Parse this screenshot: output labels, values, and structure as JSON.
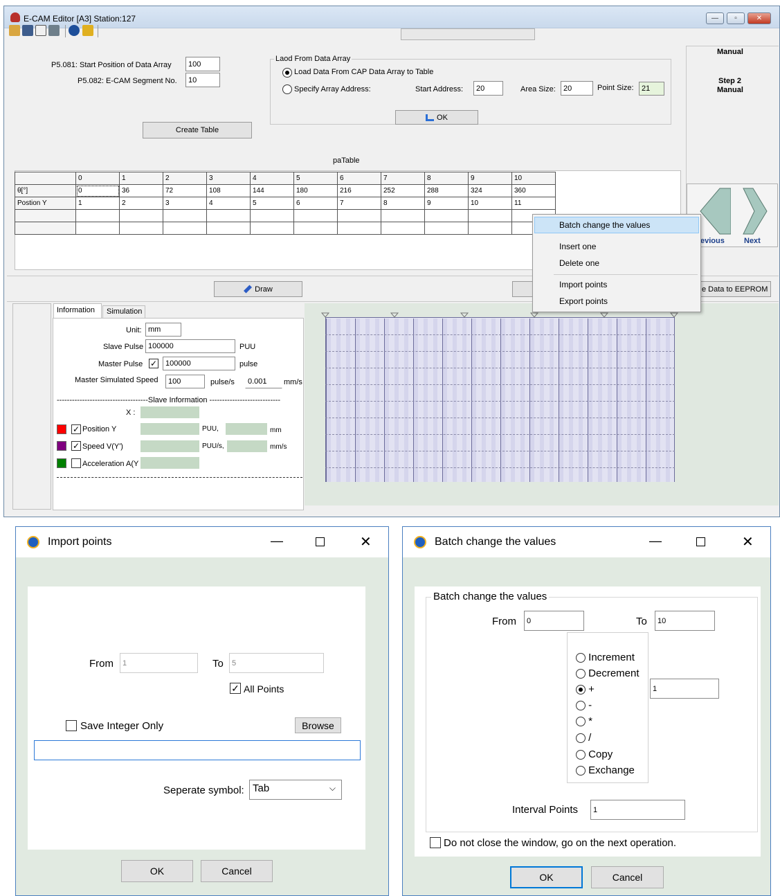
{
  "main_window": {
    "title": "E-CAM Editor [A3] Station:127",
    "controls": {
      "minimize": "—",
      "maximize": "▫",
      "close": "✕"
    }
  },
  "params": {
    "start_position_label": "P5.081: Start Position of Data Array",
    "start_position_value": "100",
    "segment_label": "P5.082: E-CAM Segment No.",
    "segment_value": "10",
    "create_table_button": "Create Table"
  },
  "load_group": {
    "title": "Laod From Data Array",
    "option_cap": "Load Data From CAP Data Array to Table",
    "option_specify": "Specify Array Address:",
    "start_address_label": "Start Address:",
    "start_address_value": "20",
    "area_size_label": "Area Size:",
    "area_size_value": "20",
    "point_size_label": "Point Size:",
    "point_size_value": "21",
    "ok_button": "OK"
  },
  "right_panel": {
    "mode": "Manual",
    "step_line1": "Step 2",
    "step_line2": "Manual",
    "previous_label": "evious",
    "next_label": "Next"
  },
  "table": {
    "title": "paTable",
    "columns": [
      "0",
      "1",
      "2",
      "3",
      "4",
      "5",
      "6",
      "7",
      "8",
      "9",
      "10"
    ],
    "row_labels": [
      "θ[°]",
      "Postion Y"
    ],
    "theta": [
      "0",
      "36",
      "72",
      "108",
      "144",
      "180",
      "216",
      "252",
      "288",
      "324",
      "360"
    ],
    "position_y": [
      "1",
      "2",
      "3",
      "4",
      "5",
      "6",
      "7",
      "8",
      "9",
      "10",
      "11"
    ]
  },
  "context_menu": {
    "items": [
      "Batch change the values",
      "Insert one",
      "Delete one",
      "Import points",
      "Export points"
    ]
  },
  "draw_bar": {
    "draw_button": "Draw",
    "eeprom_button": "e Data to EEPROM"
  },
  "info_panel": {
    "tabs": [
      "Information",
      "Simulation"
    ],
    "unit_label": "Unit:",
    "unit_value": "mm",
    "slave_pulse_label": "Slave Pulse",
    "slave_pulse_value": "100000",
    "slave_pulse_unit": "PUU",
    "master_pulse_label": "Master Pulse",
    "master_pulse_value": "100000",
    "master_pulse_unit": "pulse",
    "master_speed_label": "Master Simulated Speed",
    "master_speed_value": "100",
    "master_speed_unit": "pulse/s",
    "master_speed_mm_value": "0.001",
    "master_speed_mm_unit": "mm/s",
    "slave_info_label": "------------------------------------Slave Information ----------------------------",
    "x_label": "X :",
    "position_y_label": "Position Y",
    "position_y_unit1": "PUU,",
    "position_y_unit2": "mm",
    "speed_label": "Speed V(Y')",
    "speed_unit1": "PUU/s,",
    "speed_unit2": "mm/s",
    "accel_label": "Acceleration A(Y",
    "colors": {
      "position": "#ff0000",
      "speed": "#800080",
      "accel": "#008000"
    }
  },
  "import_dialog": {
    "title": "Import points",
    "from_label": "From",
    "from_value": "1",
    "to_label": "To",
    "to_value": "5",
    "all_points_label": "All Points",
    "save_integer_label": "Save Integer Only",
    "browse_button": "Browse",
    "path_value": "",
    "separate_label": "Seperate symbol:",
    "separate_value": "Tab",
    "ok_button": "OK",
    "cancel_button": "Cancel"
  },
  "batch_dialog": {
    "title": "Batch change the values",
    "group_title": "Batch change the values",
    "from_label": "From",
    "from_value": "0",
    "to_label": "To",
    "to_value": "10",
    "options": [
      "Increment",
      "Decrement",
      "+",
      "-",
      "*",
      "/",
      "Copy",
      "Exchange"
    ],
    "selected_option": "+",
    "operand_value": "1",
    "interval_label": "Interval Points",
    "interval_value": "1",
    "do_not_close_label": "Do not close the window, go on the next operation.",
    "ok_button": "OK",
    "cancel_button": "Cancel"
  }
}
